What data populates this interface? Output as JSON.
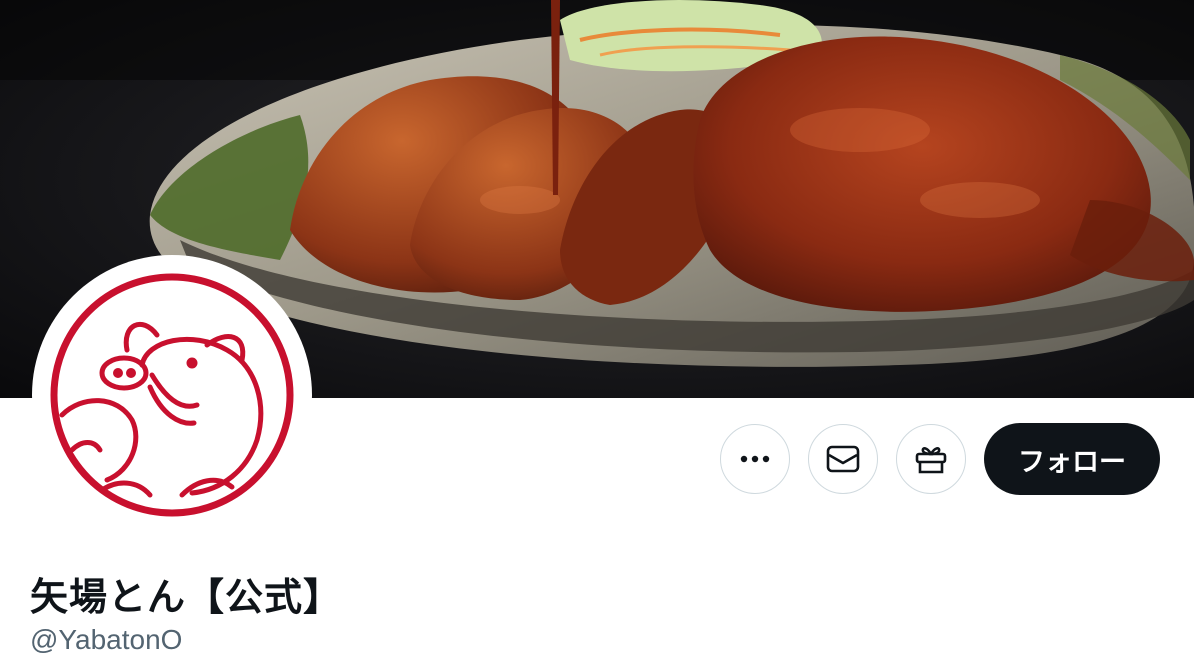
{
  "profile": {
    "display_name": "矢場とん【公式】",
    "handle": "@YabatonO"
  },
  "actions": {
    "more_icon": "more-icon",
    "message_icon": "envelope-icon",
    "gift_icon": "gift-icon",
    "follow_label": "フォロー"
  },
  "banner": {
    "subject": "miso katsu plate photo"
  },
  "avatar": {
    "logo": "pig-logo"
  },
  "colors": {
    "brand_red": "#c8102e",
    "follow_bg": "#0f1419",
    "handle_gray": "#536471",
    "button_border": "#cfd9de"
  }
}
